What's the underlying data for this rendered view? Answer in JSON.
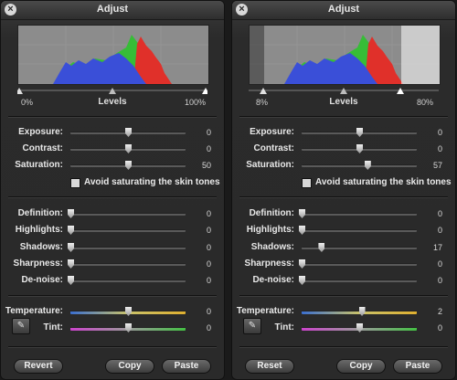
{
  "panels": [
    {
      "title": "Adjust",
      "levels": {
        "title": "Levels",
        "min_label": "0%",
        "max_label": "100%"
      },
      "sliders": [
        {
          "label": "Exposure:",
          "value": "0"
        },
        {
          "label": "Contrast:",
          "value": "0"
        },
        {
          "label": "Saturation:",
          "value": "50"
        },
        {
          "label": "Definition:",
          "value": "0"
        },
        {
          "label": "Highlights:",
          "value": "0"
        },
        {
          "label": "Shadows:",
          "value": "0"
        },
        {
          "label": "Sharpness:",
          "value": "0"
        },
        {
          "label": "De-noise:",
          "value": "0"
        },
        {
          "label": "Temperature:",
          "value": "0"
        },
        {
          "label": "Tint:",
          "value": "0"
        }
      ],
      "checkbox_label": "Avoid saturating the skin tones",
      "buttons": {
        "reset": "Revert",
        "copy": "Copy",
        "paste": "Paste"
      }
    },
    {
      "title": "Adjust",
      "levels": {
        "title": "Levels",
        "min_label": "8%",
        "max_label": "80%"
      },
      "sliders": [
        {
          "label": "Exposure:",
          "value": "0"
        },
        {
          "label": "Contrast:",
          "value": "0"
        },
        {
          "label": "Saturation:",
          "value": "57"
        },
        {
          "label": "Definition:",
          "value": "0"
        },
        {
          "label": "Highlights:",
          "value": "0"
        },
        {
          "label": "Shadows:",
          "value": "17"
        },
        {
          "label": "Sharpness:",
          "value": "0"
        },
        {
          "label": "De-noise:",
          "value": "0"
        },
        {
          "label": "Temperature:",
          "value": "2"
        },
        {
          "label": "Tint:",
          "value": "0"
        }
      ],
      "checkbox_label": "Avoid saturating the skin tones",
      "buttons": {
        "reset": "Reset",
        "copy": "Copy",
        "paste": "Paste"
      }
    }
  ],
  "colors": {
    "red": "#e0302a",
    "green": "#2ec22e",
    "blue": "#3a4fd8",
    "bg": "#2a2a2a"
  },
  "icons": {
    "close": "close-icon",
    "eyedropper": "eyedropper-icon"
  }
}
